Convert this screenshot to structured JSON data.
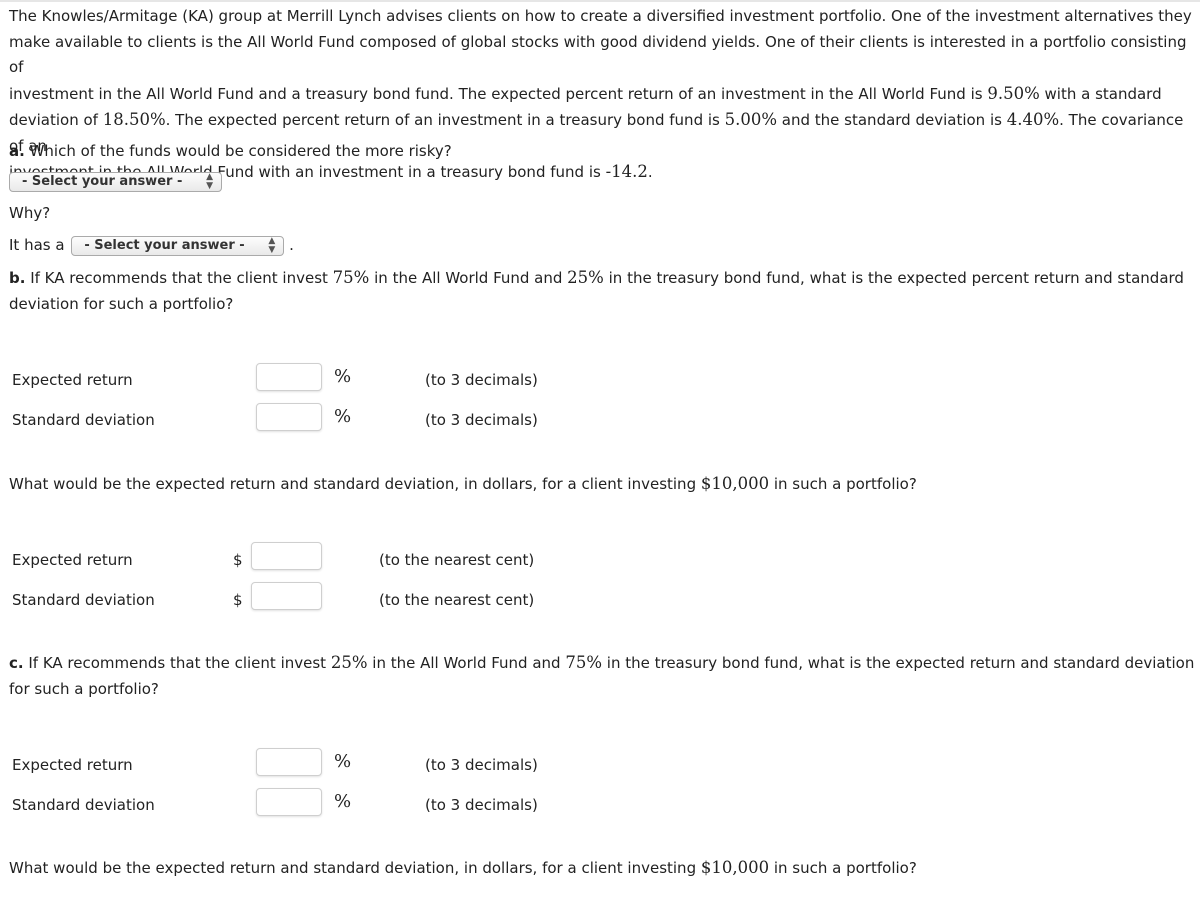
{
  "intro": {
    "line1": "The Knowles/Armitage (KA) group at Merrill Lynch advises clients on how to create a diversified investment portfolio. One of the investment alternatives they",
    "line2": "make available to clients is the All World Fund composed of global stocks with good dividend yields. One of their clients is interested in a portfolio consisting of",
    "line3_pre": "investment in the All World Fund and a treasury bond fund. The expected percent return of an investment in the All World Fund is ",
    "awf_return": "9.50%",
    "line3_post": " with a standard",
    "line4_pre": "deviation of ",
    "awf_sd": "18.50%",
    "line4_mid": ". The expected percent return of an investment in a treasury bond fund is ",
    "tb_return": "5.00%",
    "line4_mid2": " and the standard deviation is ",
    "tb_sd": "4.40%",
    "line4_post": ". The covariance of an",
    "line5_pre": "investment in the All World Fund with an investment in a treasury bond fund is ",
    "covariance": "-14.2",
    "line5_post": "."
  },
  "part_a": {
    "label": "a.",
    "question": " Which of the funds would be considered the more risky?",
    "select1_value": "- Select your answer -",
    "why": "Why?",
    "it_has_a": "It has a",
    "select2_value": "- Select your answer -",
    "period": "."
  },
  "part_b": {
    "label": "b.",
    "q_pre": " If KA recommends that the client invest ",
    "pct1": "75%",
    "q_mid": " in the All World Fund and ",
    "pct2": "25%",
    "q_post": " in the treasury bond fund, what is the expected percent return and standard",
    "q_line2": "deviation for such a portfolio?",
    "rows": [
      {
        "label": "Expected return",
        "unit": "%",
        "hint": "(to 3 decimals)",
        "value": ""
      },
      {
        "label": "Standard deviation",
        "unit": "%",
        "hint": "(to 3 decimals)",
        "value": ""
      }
    ],
    "dollar_q_pre": "What would be the expected return and standard deviation, in dollars, for a client investing ",
    "dollar_amount": "$10,000",
    "dollar_q_post": " in such a portfolio?",
    "dollar_rows": [
      {
        "label": "Expected return",
        "unit": "$",
        "hint": "(to the nearest cent)",
        "value": ""
      },
      {
        "label": "Standard deviation",
        "unit": "$",
        "hint": "(to the nearest cent)",
        "value": ""
      }
    ]
  },
  "part_c": {
    "label": "c.",
    "q_pre": " If KA recommends that the client invest ",
    "pct1": "25%",
    "q_mid": " in the All World Fund and ",
    "pct2": "75%",
    "q_post": " in the treasury bond fund, what is the expected return and standard deviation",
    "q_line2": "for such a portfolio?",
    "rows": [
      {
        "label": "Expected return",
        "unit": "%",
        "hint": "(to 3 decimals)",
        "value": ""
      },
      {
        "label": "Standard deviation",
        "unit": "%",
        "hint": "(to 3 decimals)",
        "value": ""
      }
    ],
    "dollar_q_pre": "What would be the expected return and standard deviation, in dollars, for a client investing ",
    "dollar_amount": "$10,000",
    "dollar_q_post": " in such a portfolio?"
  }
}
